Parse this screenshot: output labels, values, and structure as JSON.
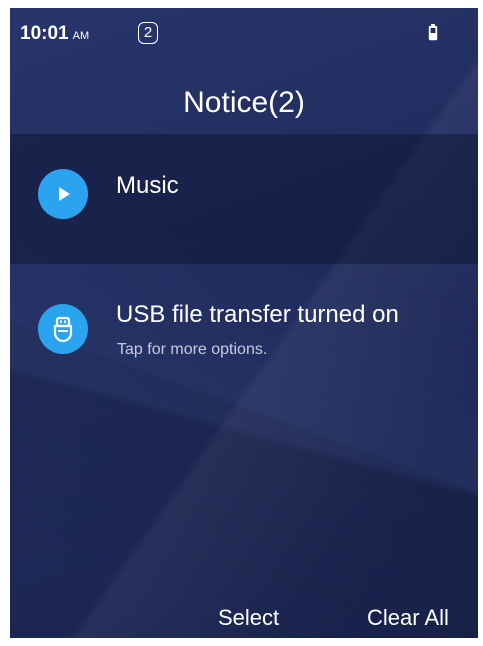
{
  "status_bar": {
    "time": "10:01",
    "ampm": "AM",
    "notification_count": "2",
    "battery_icon": "battery-icon"
  },
  "header": {
    "title": "Notice(2)"
  },
  "notifications": [
    {
      "title": "Music",
      "subtitle": "",
      "icon": "play-icon",
      "icon_color": "#2aa4ef",
      "highlighted": true
    },
    {
      "title": "USB file transfer turned on",
      "subtitle": "Tap for more options.",
      "icon": "usb-icon",
      "icon_color": "#2aa4ef",
      "highlighted": false
    }
  ],
  "actions": {
    "select_label": "Select",
    "clear_all_label": "Clear All"
  },
  "colors": {
    "background": "#212d5f",
    "accent": "#2aa4ef",
    "text": "#ffffff",
    "subtext": "#c7cbe0"
  }
}
